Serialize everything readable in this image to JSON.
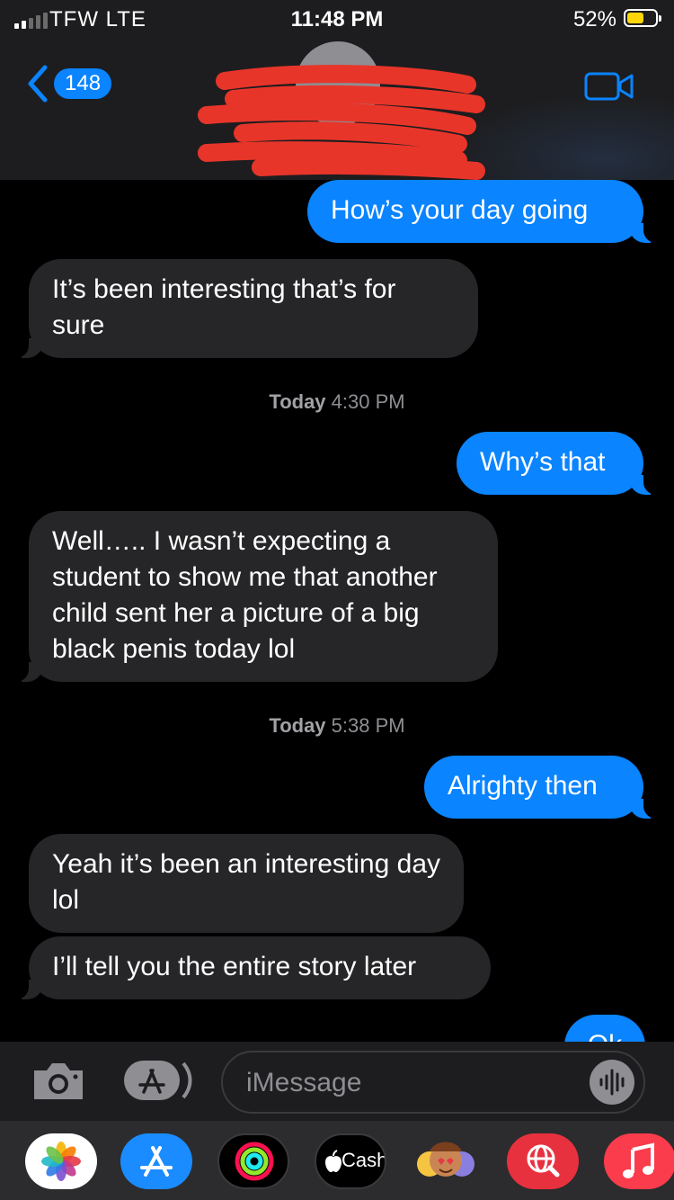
{
  "status_bar": {
    "carrier": "TFW  LTE",
    "time": "11:48 PM",
    "battery_percent": "52%",
    "battery_level": 0.52,
    "signal_bars": 5,
    "signal_bars_filled": 2
  },
  "header": {
    "unread_count": "148",
    "contact_name_redacted": true
  },
  "thread": {
    "messages": [
      {
        "direction": "out",
        "text": "How’s your day going"
      },
      {
        "direction": "in",
        "text": "It’s been interesting that’s for sure"
      },
      {
        "direction": "out",
        "text": "Why’s that"
      },
      {
        "direction": "in",
        "text": "Well….. I wasn’t expecting a student to show me that another child sent her a picture of a big black penis today lol"
      },
      {
        "direction": "out",
        "text": "Alrighty then"
      },
      {
        "direction": "in",
        "text": "Yeah it’s been an interesting day lol"
      },
      {
        "direction": "in",
        "text": "I’ll tell you the entire story later"
      },
      {
        "direction": "out",
        "text": "Ok"
      }
    ],
    "timestamps": [
      {
        "day": "Today",
        "time": "4:30 PM"
      },
      {
        "day": "Today",
        "time": "5:38 PM"
      }
    ]
  },
  "compose": {
    "placeholder": "iMessage"
  },
  "app_drawer": {
    "apps": [
      {
        "name": "photos-app",
        "icon": "photos-flower-icon"
      },
      {
        "name": "app-store",
        "icon": "app-store-icon"
      },
      {
        "name": "activity",
        "icon": "activity-rings-icon"
      },
      {
        "name": "apple-cash",
        "label": "Cash",
        "icon": "apple-logo-icon"
      },
      {
        "name": "memoji",
        "icon": "memoji-faces-icon"
      },
      {
        "name": "web-search",
        "icon": "globe-search-icon"
      },
      {
        "name": "music",
        "icon": "music-note-icon"
      }
    ]
  },
  "colors": {
    "outgoing_bubble": "#0a84ff",
    "incoming_bubble": "#262628",
    "background": "#000000",
    "battery_fill": "#ffd60a",
    "timestamp": "#8e8e93"
  }
}
